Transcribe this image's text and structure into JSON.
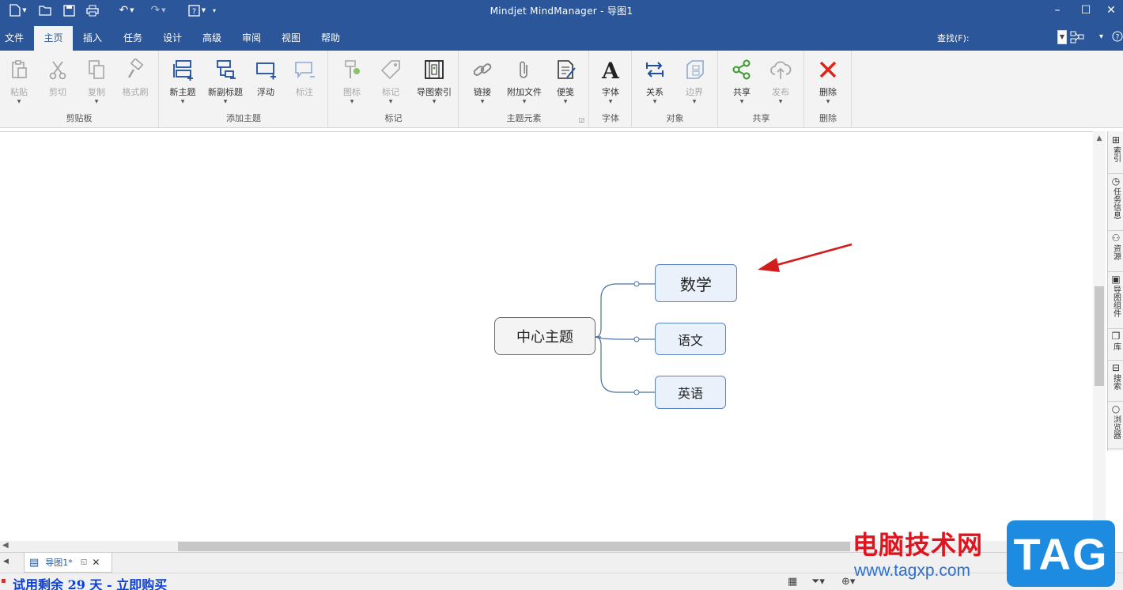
{
  "window": {
    "title": "Mindjet MindManager - 导图1"
  },
  "menu": {
    "tabs": [
      "文件",
      "主页",
      "插入",
      "任务",
      "设计",
      "高级",
      "审阅",
      "视图",
      "帮助"
    ],
    "active_tab": "主页",
    "find_label": "查找(F):"
  },
  "ribbon": {
    "groups": [
      {
        "label": "剪贴板",
        "buttons": [
          "粘贴",
          "剪切",
          "复制",
          "格式刷"
        ]
      },
      {
        "label": "添加主题",
        "buttons": [
          "新主题",
          "新副标题",
          "浮动",
          "标注"
        ]
      },
      {
        "label": "标记",
        "buttons": [
          "图标",
          "标记",
          "导图索引"
        ]
      },
      {
        "label": "主题元素",
        "buttons": [
          "链接",
          "附加文件",
          "便笺"
        ]
      },
      {
        "label": "字体",
        "buttons": [
          "字体"
        ]
      },
      {
        "label": "对象",
        "buttons": [
          "关系",
          "边界"
        ]
      },
      {
        "label": "共享",
        "buttons": [
          "共享",
          "发布"
        ]
      },
      {
        "label": "删除",
        "buttons": [
          "删除"
        ]
      }
    ]
  },
  "mindmap": {
    "central_topic": "中心主题",
    "subtopics": [
      "数学",
      "语文",
      "英语"
    ],
    "line_color": "#4a6fa5",
    "arrow_color": "#d41c1c"
  },
  "dock": {
    "items": [
      "索引",
      "任务信息",
      "资源",
      "导图组件",
      "库",
      "搜索",
      "浏览器"
    ]
  },
  "doc_tabs": {
    "name": "导图1*"
  },
  "status": {
    "trial_text": "试用剩余 29 天 - 立即购买"
  },
  "watermark": {
    "cn": "电脑技术网",
    "url": "www.tagxp.com",
    "tag": "TAG"
  },
  "colors": {
    "titlebar": "#2b579a",
    "ribbon_bg": "#f3f3f3",
    "subtopic_fill": "#eaf1fa",
    "subtopic_border": "#5b84c4"
  }
}
